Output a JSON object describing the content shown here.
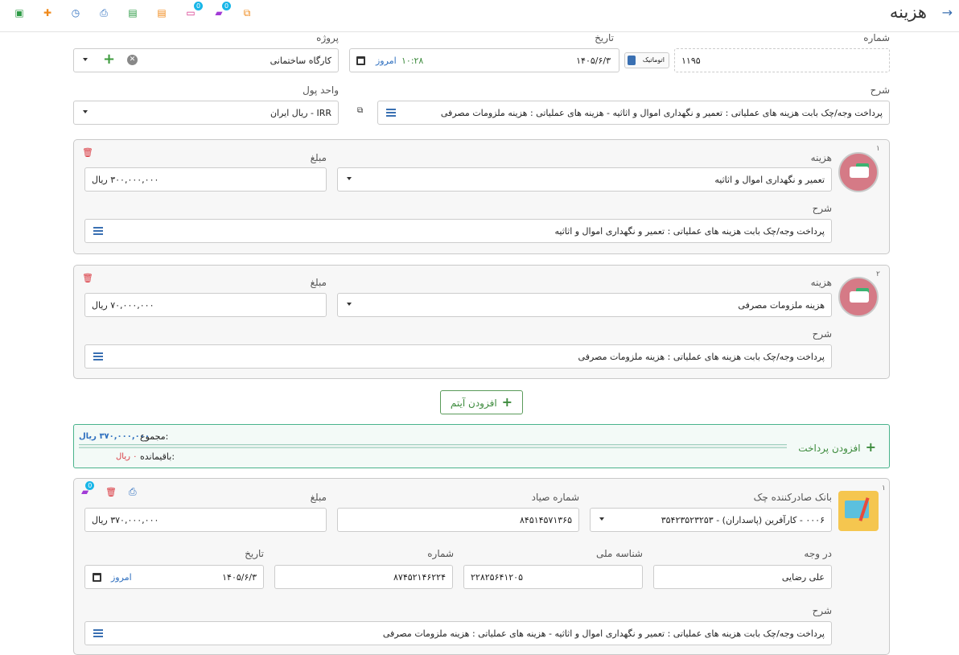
{
  "header": {
    "title": "هزینه",
    "back_icon": "arrow-right-icon",
    "toolbar_icons": [
      "save-icon",
      "new-doc-icon",
      "history-icon",
      "print-icon",
      "excel-icon",
      "export-icon",
      "notes-icon",
      "comments-icon",
      "copy-icon"
    ],
    "badge_value": "0"
  },
  "form": {
    "number_label": "شماره",
    "number_value": "۱۱۹۵",
    "auto_label": "اتوماتیک",
    "date_label": "تاریخ",
    "date_value": "۱۴۰۵/۶/۳",
    "time_value": "۱۰:۲۸",
    "today_label": "امروز",
    "project_label": "پروژه",
    "project_value": "کارگاه ساختمانی",
    "description_label": "شرح",
    "description_value": "پرداخت وجه/چک بابت هزینه های عملیاتی : تعمیر و نگهداری اموال و اثاثیه - هزینه های عملیاتی : هزینه ملزومات مصرفی",
    "currency_label": "واحد پول",
    "currency_value": "IRR - ریال ایران"
  },
  "items": [
    {
      "index": "۱",
      "expense_label": "هزینه",
      "expense_value": "تعمیر و نگهداری اموال و اثاثیه",
      "amount_label": "مبلغ",
      "amount_value": "۳۰۰,۰۰۰,۰۰۰ ریال",
      "desc_label": "شرح",
      "desc_value": "پرداخت وجه/چک بابت هزینه های عملیاتی : تعمیر و نگهداری اموال و اثاثیه"
    },
    {
      "index": "۲",
      "expense_label": "هزینه",
      "expense_value": "هزینه ملزومات مصرفی",
      "amount_label": "مبلغ",
      "amount_value": "۷۰,۰۰۰,۰۰۰ ریال",
      "desc_label": "شرح",
      "desc_value": "پرداخت وجه/چک بابت هزینه های عملیاتی : هزینه ملزومات مصرفی"
    }
  ],
  "add_item_label": "افزودن آیتم",
  "summary": {
    "add_payment_label": "افزودن پرداخت",
    "total_label": "مجموع:",
    "total_value": "۳۷۰,۰۰۰,۰۰۰ ریال",
    "remaining_label": "باقیمانده:",
    "remaining_value": "۰ ریال"
  },
  "payment": {
    "index": "۱",
    "bank_label": "بانک صادرکننده چک",
    "bank_value": "۰۰۰۶ - کارآفرین (پاسداران) - ۳۵۴۲۳۵۲۳۲۵۳",
    "sayad_label": "شماره صیاد",
    "sayad_value": "۸۴۵۱۴۵۷۱۳۶۵",
    "amount_label": "مبلغ",
    "amount_value": "۳۷۰,۰۰۰,۰۰۰ ریال",
    "payee_label": "در وجه",
    "payee_value": "علی رضایی",
    "national_id_label": "شناسه ملی",
    "national_id_value": "۲۲۸۲۵۶۴۱۲۰۵",
    "number_label": "شماره",
    "number_value": "۸۷۴۵۲۱۴۶۲۲۴",
    "date_label": "تاریخ",
    "date_value": "۱۴۰۵/۶/۳",
    "today_label": "امروز",
    "desc_label": "شرح",
    "desc_value": "پرداخت وجه/چک بابت هزینه های عملیاتی : تعمیر و نگهداری اموال و اثاثیه - هزینه های عملیاتی : هزینه ملزومات مصرفی"
  },
  "colors": {
    "accent_blue": "#2e6fbf",
    "green": "#3d8b3d",
    "danger": "#d9363e",
    "summary_border": "#49b38c"
  }
}
